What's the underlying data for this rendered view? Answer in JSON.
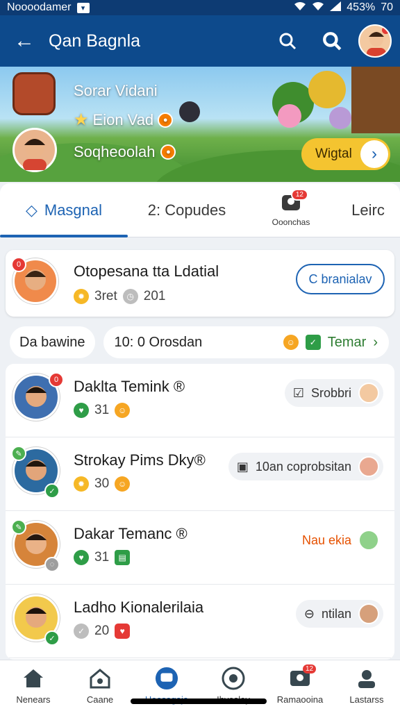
{
  "status_bar": {
    "carrier": "Noooodamer",
    "battery": "453%",
    "time": "70"
  },
  "header": {
    "title": "Qan Bagnla"
  },
  "banner": {
    "line1": "Sorar Vidani",
    "line2": "Eion Vad",
    "line3": "Soqheoolah",
    "cta_label": "Wigtal"
  },
  "tabs": [
    {
      "label": "Masgnal",
      "active": true
    },
    {
      "label": "2: Copudes"
    },
    {
      "label": "Ooonchas",
      "badge": "12"
    },
    {
      "label": "Leirc"
    }
  ],
  "featured": {
    "name": "Otopesana tta Ldatial",
    "stat1": "3ret",
    "stat2": "201",
    "button": "C branialav"
  },
  "filter": {
    "label": "Da bawine",
    "time": "10: 0 Orosdan",
    "action": "Temar"
  },
  "friends": [
    {
      "name": "Daklta Temink ®",
      "score": "31",
      "action": "Srobbri"
    },
    {
      "name": "Strokay Pims Dky®",
      "score": "30",
      "action": "10an coprobsitan"
    },
    {
      "name": "Dakar Temanc ®",
      "score": "31",
      "action": "Nau ekia"
    },
    {
      "name": "Ladho Kionalerilaia",
      "score": "20",
      "action": "ntilan"
    }
  ],
  "bottom_nav": [
    {
      "label": "Nenears"
    },
    {
      "label": "Caane"
    },
    {
      "label": "Heesagaja",
      "active": true
    },
    {
      "label": "Ihveslay"
    },
    {
      "label": "Ramaooina",
      "badge": "12"
    },
    {
      "label": "Lastarss"
    }
  ],
  "colors": {
    "primary": "#0d4a8c",
    "accent": "#1d63b3",
    "cta": "#f4c430",
    "badge": "#e53935",
    "green": "#2e9d47"
  }
}
